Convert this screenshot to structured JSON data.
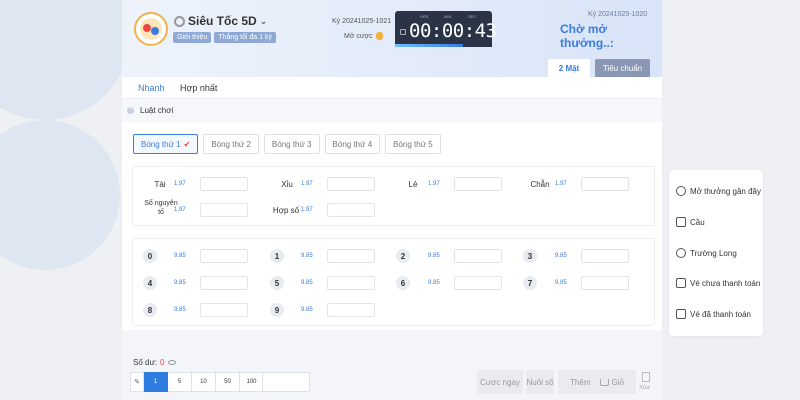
{
  "header": {
    "game_title": "Siêu Tốc 5D",
    "chip_intro": "Giới thiệu",
    "chip_freq": "Thắng tối đa 1 kỳ",
    "round_label": "Kỳ 20241025-1021",
    "bet_open_label": "Mở cược",
    "timer": {
      "hrs_label": "HRS",
      "min_label": "MIN",
      "sec_label": "SEC",
      "digits": "00:00:43",
      "progress": 0.7
    },
    "prev_round_label": "Kỳ 20241025-1020",
    "waiting_text": "Chờ mở thưởng..:"
  },
  "mode_tabs": {
    "two_face": "2 Mặt",
    "standard": "Tiêu chuẩn"
  },
  "sub_tabs": {
    "fast": "Nhanh",
    "combined": "Hợp nhất"
  },
  "rules_label": "Luật chơi",
  "ball_tabs": [
    "Bóng thứ 1",
    "Bóng thứ 2",
    "Bóng thứ 3",
    "Bóng thứ 4",
    "Bóng thứ 5"
  ],
  "bet_options": [
    {
      "label": "Tài",
      "odds": "1.97"
    },
    {
      "label": "Xỉu",
      "odds": "1.97"
    },
    {
      "label": "Lẻ",
      "odds": "1.97"
    },
    {
      "label": "Chẵn",
      "odds": "1.97"
    },
    {
      "label": "Số nguyên tố",
      "odds": "1.97"
    },
    {
      "label": "Hợp số",
      "odds": "1.97"
    }
  ],
  "numbers": [
    {
      "num": "0",
      "odds": "9.85"
    },
    {
      "num": "1",
      "odds": "9.85"
    },
    {
      "num": "2",
      "odds": "9.85"
    },
    {
      "num": "3",
      "odds": "9.85"
    },
    {
      "num": "4",
      "odds": "9.85"
    },
    {
      "num": "5",
      "odds": "9.85"
    },
    {
      "num": "6",
      "odds": "9.85"
    },
    {
      "num": "7",
      "odds": "9.85"
    },
    {
      "num": "8",
      "odds": "9.85"
    },
    {
      "num": "9",
      "odds": "9.85"
    }
  ],
  "bottom": {
    "balance_label": "Số dư:",
    "balance_value": "0",
    "chips": [
      "1",
      "5",
      "10",
      "50",
      "100"
    ],
    "bet_now": "Cược ngay",
    "chase": "Nuôi số",
    "add": "Thêm",
    "cart": "Giỏ",
    "delete": "Xóa"
  },
  "side_menu": [
    "Mở thưởng gần đây",
    "Cầu",
    "Trường Long",
    "Vé chưa thanh toán",
    "Vé đã thanh toán"
  ]
}
